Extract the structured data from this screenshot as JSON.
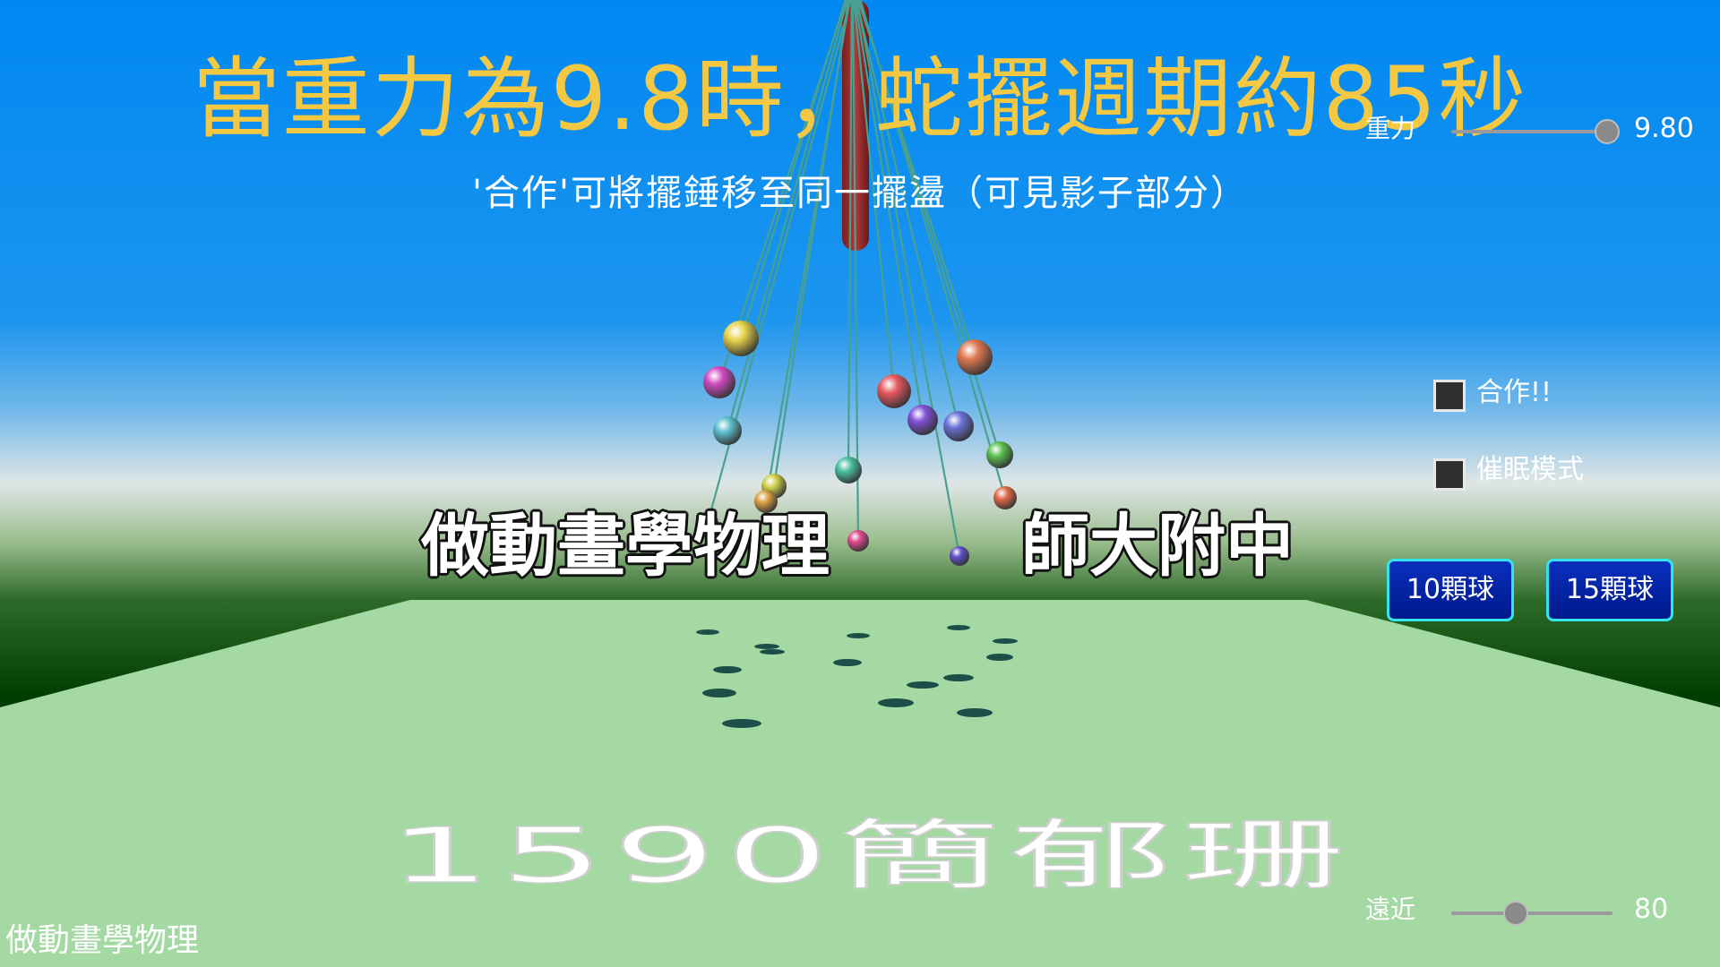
{
  "title": "當重力為9.8時，蛇擺週期約85秒",
  "subtitle": "'合作'可將擺錘移至同一擺盪（可見影子部分）",
  "watermark": {
    "left": "做動畫學物理",
    "right": "師大附中",
    "floor": "1590簡郁珊"
  },
  "gravity": {
    "label": "重力",
    "value": "9.80",
    "level": 1.0
  },
  "distance": {
    "label": "遠近",
    "value": "80",
    "level": 0.4
  },
  "options": [
    {
      "label": "合作!!",
      "checked": false
    },
    {
      "label": "催眠模式",
      "checked": false
    }
  ],
  "buttons": {
    "ten_balls": "10顆球",
    "fifteen_balls": "15顆球"
  },
  "footer": "做動畫學物理",
  "colors": {
    "sky_top": "#0088f2",
    "sky_mid": "#3a9ee8",
    "horizon": "#dfe6e6",
    "grass_dark": "#003d00",
    "floor": "#a4d9a4",
    "title": "#f4c842",
    "button_border": "#32e4ee",
    "button_fill": "#0a2fbf",
    "pole": "#a03030",
    "string": "#4aa090"
  },
  "pendulums": [
    {
      "name": "pendulum-ball-yellow",
      "color": "#e6d24a"
    },
    {
      "name": "pendulum-ball-magenta",
      "color": "#d04ac0"
    },
    {
      "name": "pendulum-ball-cyan",
      "color": "#5ec0d0"
    },
    {
      "name": "pendulum-ball-olive",
      "color": "#cdd04a"
    },
    {
      "name": "pendulum-ball-orange",
      "color": "#d8a040"
    },
    {
      "name": "pendulum-ball-violet",
      "color": "#b050e0"
    },
    {
      "name": "pendulum-ball-teal",
      "color": "#48c0a0"
    },
    {
      "name": "pendulum-ball-pink",
      "color": "#e04a90"
    },
    {
      "name": "pendulum-ball-red",
      "color": "#e65860"
    },
    {
      "name": "pendulum-ball-purple",
      "color": "#8050d8"
    },
    {
      "name": "pendulum-ball-blue",
      "color": "#6a70d8"
    },
    {
      "name": "pendulum-ball-indigo",
      "color": "#6050c8"
    },
    {
      "name": "pendulum-ball-salmon",
      "color": "#e07850"
    },
    {
      "name": "pendulum-ball-green",
      "color": "#5ac050"
    },
    {
      "name": "pendulum-ball-coral",
      "color": "#e06a48"
    }
  ]
}
